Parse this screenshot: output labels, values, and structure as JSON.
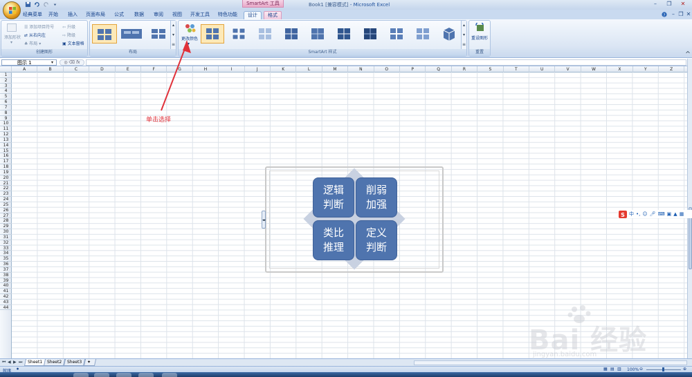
{
  "app": {
    "title_doc": "Book1",
    "title_mode": "[兼容模式]",
    "title_app": "- Microsoft Excel",
    "context_group": "SmartArt 工具"
  },
  "tabs": [
    {
      "label": "经典菜单"
    },
    {
      "label": "开始"
    },
    {
      "label": "插入"
    },
    {
      "label": "页面布局"
    },
    {
      "label": "公式"
    },
    {
      "label": "数据"
    },
    {
      "label": "审阅"
    },
    {
      "label": "视图"
    },
    {
      "label": "开发工具"
    },
    {
      "label": "特色功能"
    },
    {
      "label": "设计"
    },
    {
      "label": "格式"
    }
  ],
  "ribbon": {
    "create": {
      "label": "创建图形",
      "add_shape": "添加形状",
      "add_bullet": "添加项目符号",
      "rtl": "从右向左",
      "layout": "布局",
      "promote": "升级",
      "demote": "降级",
      "text_pane": "文本窗格"
    },
    "layouts": {
      "label": "布局"
    },
    "styles": {
      "label": "SmartArt 样式",
      "change_colors": "更改颜色"
    },
    "reset": {
      "label": "重置",
      "reset_graphic": "重设图形"
    }
  },
  "formula_bar": {
    "name_box": "图示 1",
    "fx": "fx"
  },
  "columns": [
    "A",
    "B",
    "C",
    "D",
    "E",
    "F",
    "G",
    "H",
    "I",
    "J",
    "K",
    "L",
    "M",
    "N",
    "O",
    "P",
    "Q",
    "R",
    "S",
    "T",
    "U",
    "V",
    "W",
    "X",
    "Y",
    "Z"
  ],
  "rows": [
    "1",
    "2",
    "3",
    "4",
    "5",
    "6",
    "7",
    "8",
    "9",
    "10",
    "11",
    "12",
    "13",
    "14",
    "15",
    "16",
    "17",
    "18",
    "19",
    "20",
    "21",
    "22",
    "23",
    "24",
    "25",
    "26",
    "27",
    "28",
    "29",
    "30",
    "31",
    "32",
    "33",
    "34",
    "35",
    "36",
    "37",
    "38",
    "39",
    "40",
    "41",
    "42",
    "43",
    "44"
  ],
  "smartart": {
    "tl": "逻辑\n判断",
    "tr": "削弱\n加强",
    "bl": "类比\n推理",
    "br": "定义\n判断",
    "fill": "#4f74ae"
  },
  "annotation": {
    "text": "单击选择",
    "color": "#e0313a"
  },
  "sheets": [
    {
      "label": "Sheet1"
    },
    {
      "label": "Sheet2"
    },
    {
      "label": "Sheet3"
    }
  ],
  "status": {
    "ready": "就绪",
    "zoom": "100%"
  },
  "ime": {
    "lang": "中"
  },
  "watermark": {
    "brand": "Bai 经验",
    "url": "jingyan.baidu.com"
  }
}
